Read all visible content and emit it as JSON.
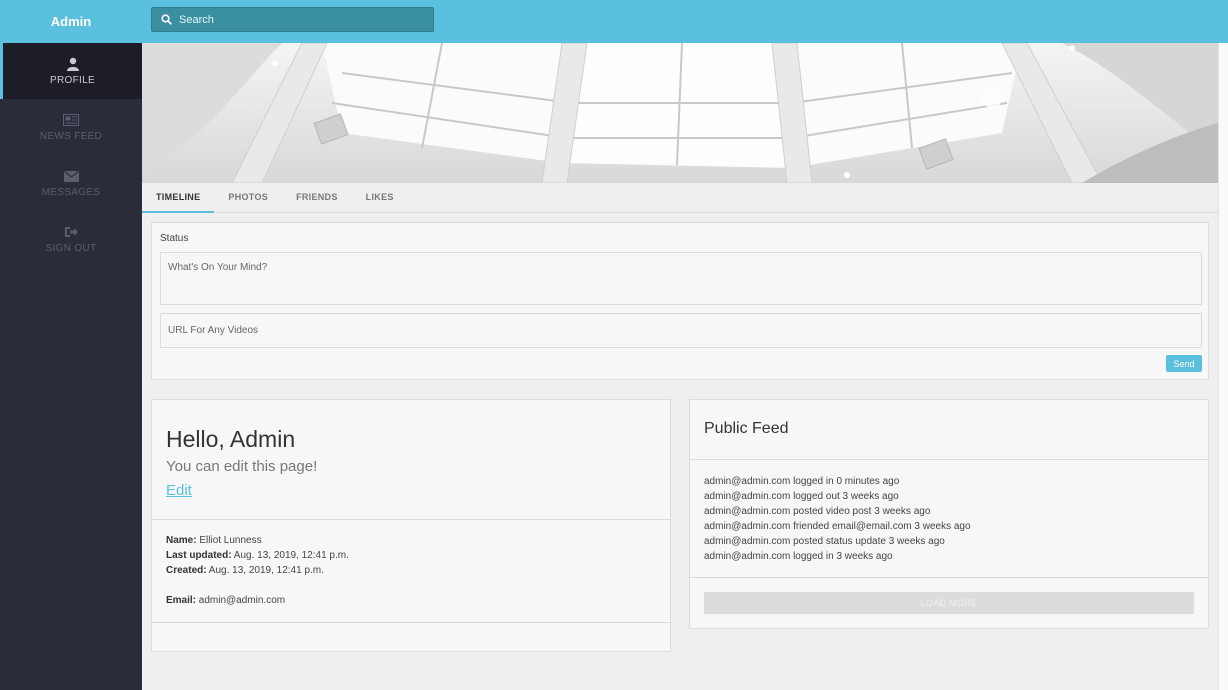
{
  "sidebar": {
    "brand": "Admin",
    "items": [
      {
        "label": "PROFILE",
        "icon": "user-icon",
        "active": true
      },
      {
        "label": "NEWS FEED",
        "icon": "newspaper-icon",
        "active": false
      },
      {
        "label": "MESSAGES",
        "icon": "envelope-icon",
        "active": false
      },
      {
        "label": "SIGN OUT",
        "icon": "sign-out-icon",
        "active": false
      }
    ]
  },
  "topbar": {
    "search_placeholder": "Search",
    "search_icon": "search-icon"
  },
  "tabs": [
    {
      "label": "TIMELINE",
      "active": true
    },
    {
      "label": "PHOTOS",
      "active": false
    },
    {
      "label": "FRIENDS",
      "active": false
    },
    {
      "label": "LIKES",
      "active": false
    }
  ],
  "status": {
    "label": "Status",
    "mind_placeholder": "What's On Your Mind?",
    "url_placeholder": "URL For Any Videos",
    "send_label": "Send"
  },
  "hello": {
    "title": "Hello, Admin",
    "subtitle": "You can edit this page!",
    "edit_label": "Edit",
    "name_label": "Name:",
    "name_value": " Elliot Lunness",
    "updated_label": "Last updated:",
    "updated_value": " Aug. 13, 2019, 12:41 p.m.",
    "created_label": "Created:",
    "created_value": " Aug. 13, 2019, 12:41 p.m.",
    "email_label": "Email:",
    "email_value": " admin@admin.com"
  },
  "feed": {
    "title": "Public Feed",
    "items": [
      "admin@admin.com logged in 0 minutes ago",
      "admin@admin.com logged out 3 weeks ago",
      "admin@admin.com posted video post 3 weeks ago",
      "admin@admin.com friended email@email.com 3 weeks ago",
      "admin@admin.com posted status update 3 weeks ago",
      "admin@admin.com logged in 3 weeks ago"
    ],
    "load_more_label": "LOAD MORE"
  },
  "colors": {
    "accent": "#5bc0de",
    "sidebar_bg": "#2b2c3a",
    "sidebar_active_bg": "#1c1d27",
    "page_bg": "#efefef"
  }
}
